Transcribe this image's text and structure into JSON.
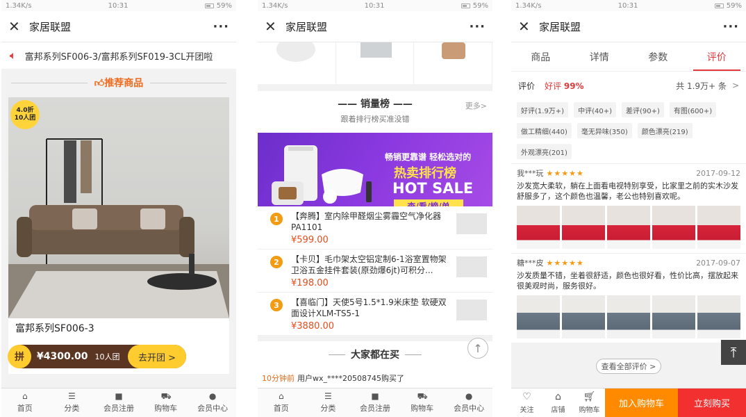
{
  "status": {
    "p1": {
      "speed": "1.34K/s",
      "time": "10:31",
      "battery": "59%"
    },
    "p2": {
      "speed": "1.34K/s",
      "time": "10:31",
      "battery": "59%"
    },
    "p3": {
      "speed": "1.34K/s",
      "time": "10:31",
      "battery": "59%"
    }
  },
  "app_title": "家居联盟",
  "close_glyph": "✕",
  "more_glyph": "···",
  "tabbar": [
    {
      "label": "首页",
      "icon": "home-icon",
      "glyph": "⌂"
    },
    {
      "label": "分类",
      "icon": "list-icon",
      "glyph": "☰"
    },
    {
      "label": "会员注册",
      "icon": "register-icon",
      "glyph": "■"
    },
    {
      "label": "购物车",
      "icon": "cart-icon",
      "glyph": "⛟"
    },
    {
      "label": "会员中心",
      "icon": "user-icon",
      "glyph": "●"
    }
  ],
  "p1": {
    "notice": "富邦系列SF006-3/富邦系列SF019-3CL开团啦",
    "rec_title": "推荐商品",
    "badge_discount": "4.0折",
    "badge_group": "10人团",
    "product_name": "富邦系列SF006-3",
    "pin_glyph": "拼",
    "price": "¥4300.00",
    "group_size": "10人团",
    "go_button": "去开团 >"
  },
  "p2": {
    "rank_title": "销量榜",
    "rank_sub": "跟着排行榜买准没错",
    "more": "更多>",
    "banner_slogan": "畅销更靠谱 轻松选对的",
    "banner_hot": "热卖排行榜",
    "banner_hs": "HOT SALE",
    "banner_look": "查/看/榜/单",
    "items": [
      {
        "rank": "1",
        "name": "【奔腾】室内除甲醛烟尘雾霾空气净化器PA1101",
        "price": "¥599.00"
      },
      {
        "rank": "2",
        "name": "【卡贝】毛巾架太空铝定制6-1浴室置物架 卫浴五金挂件套装(原劲爆6jt)可积分...",
        "price": "¥198.00"
      },
      {
        "rank": "3",
        "name": "【喜临门】天使5号1.5*1.9米床垫 软硬双面设计XLM-TS5-1",
        "price": "¥3880.00"
      }
    ],
    "section2_title": "大家都在买",
    "buyer_time": "10分钟前",
    "buyer_text": "用户wx_****20508745购买了",
    "up_glyph": "↑"
  },
  "p3": {
    "tabs": [
      {
        "label": "商品",
        "active": false
      },
      {
        "label": "详情",
        "active": false
      },
      {
        "label": "参数",
        "active": false
      },
      {
        "label": "评价",
        "active": true
      }
    ],
    "rev_label": "评价",
    "good_rate_label": "好评",
    "good_rate": "99%",
    "total": "共 1.9万+ 条",
    "chevron": ">",
    "tags": [
      "好评(1.9万+)",
      "中评(40+)",
      "差评(90+)",
      "有图(600+)",
      "做工精细(440)",
      "毫无异味(350)",
      "颜色漂亮(219)",
      "外观漂亮(201)"
    ],
    "reviews": [
      {
        "user": "我***玩",
        "stars": "★★★★★",
        "date": "2017-09-12",
        "text": "沙发宽大柔软，躺在上面看电视特别享受，比家里之前的实木沙发舒服多了，这个颜色也温馨，老公也特别喜欢呢。",
        "pic_style": "red"
      },
      {
        "user": "糖***皮",
        "stars": "★★★★★",
        "date": "2017-09-07",
        "text": "沙发质量不错，坐着很舒适，颜色也很好看，性价比高，摆放起来很美观时尚，服务很好。",
        "pic_style": "grey"
      }
    ],
    "view_all": "查看全部评价 >",
    "top_glyph": "⤒",
    "bottom": {
      "follow": "关注",
      "shop": "店铺",
      "cart": "购物车",
      "add_cart": "加入购物车",
      "buy_now": "立刻购买"
    },
    "accent_color": "#e4393c"
  }
}
